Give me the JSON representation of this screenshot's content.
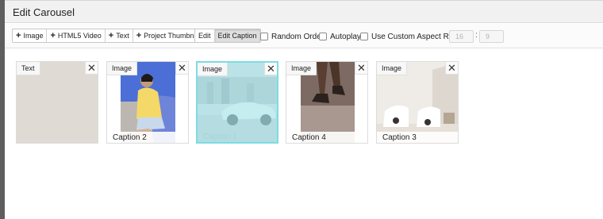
{
  "dialog": {
    "title": "Edit Carousel"
  },
  "toolbar": {
    "add_group": [
      {
        "icon": "plus-icon",
        "label": "Image"
      },
      {
        "icon": "plus-icon",
        "label": "HTML5 Video"
      },
      {
        "icon": "plus-icon",
        "label": "Text"
      },
      {
        "icon": "plus-icon",
        "label": "Project Thumbnail"
      }
    ],
    "mode_group": [
      {
        "label": "Edit",
        "active": false
      },
      {
        "label": "Edit Caption",
        "active": true
      }
    ],
    "options": {
      "random_order": {
        "label": "Random Order",
        "checked": false
      },
      "autoplay": {
        "label": "Autoplay",
        "checked": false
      },
      "custom_aspect": {
        "label": "Use Custom Aspect Ratio",
        "checked": false
      }
    },
    "aspect_ratio": {
      "width": "16",
      "separator": ":",
      "height": "9"
    }
  },
  "slides": [
    {
      "type": "Text",
      "caption": "",
      "selected": false
    },
    {
      "type": "Image",
      "caption": "Caption 2",
      "selected": false
    },
    {
      "type": "Image",
      "caption": "Caption 1",
      "selected": true
    },
    {
      "type": "Image",
      "caption": "Caption 4",
      "selected": false
    },
    {
      "type": "Image",
      "caption": "Caption 3",
      "selected": false
    }
  ],
  "colors": {
    "selected_border": "#7cdde2",
    "text_slide_bg": "#dfdbd4"
  },
  "icons": {
    "remove": "close-icon",
    "add": "plus-icon"
  }
}
